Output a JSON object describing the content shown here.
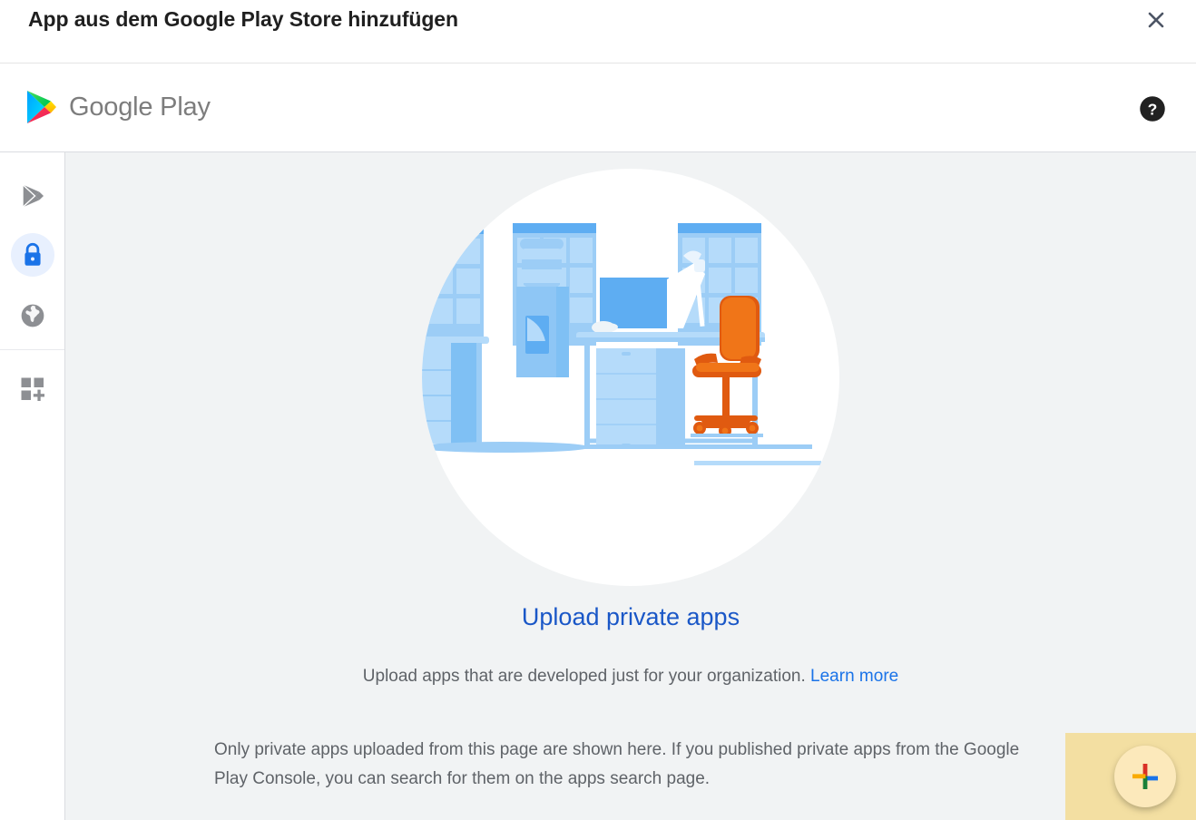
{
  "dialog": {
    "title": "App aus dem Google Play Store hinzufügen",
    "close_icon": "close-icon"
  },
  "header": {
    "brand": "Google Play",
    "logo_icon": "google-play-logo-icon",
    "help_icon": "help-circle-icon"
  },
  "sidebar": {
    "items": [
      {
        "name": "play-store",
        "icon": "play-triangle-icon",
        "active": false
      },
      {
        "name": "private-apps",
        "icon": "lock-icon",
        "active": true
      },
      {
        "name": "web-apps",
        "icon": "globe-icon",
        "active": false
      },
      {
        "name": "add-apps",
        "icon": "grid-plus-icon",
        "active": false
      }
    ]
  },
  "main": {
    "illustration": "office-workspace-illustration",
    "headline": "Upload private apps",
    "subline_text": "Upload apps that are developed just for your organization.",
    "subline_link": "Learn more",
    "note": "Only private apps uploaded from this page are shown here. If you published private apps from the Google Play Console, you can search for them on the apps search page."
  },
  "fab": {
    "label": "add-icon",
    "colors": {
      "top": "#d93025",
      "right": "#1a73e8",
      "bottom": "#188038",
      "left": "#f9ab00"
    }
  },
  "colors": {
    "accent_blue": "#1a73e8",
    "link_blue": "#1a57c7",
    "content_bg": "#f1f3f4",
    "text_secondary": "#5f6368",
    "fab_panel": "#f3dfa2",
    "fab_circle": "#fce9bb",
    "illustration_blue": "#8ec6f5"
  }
}
